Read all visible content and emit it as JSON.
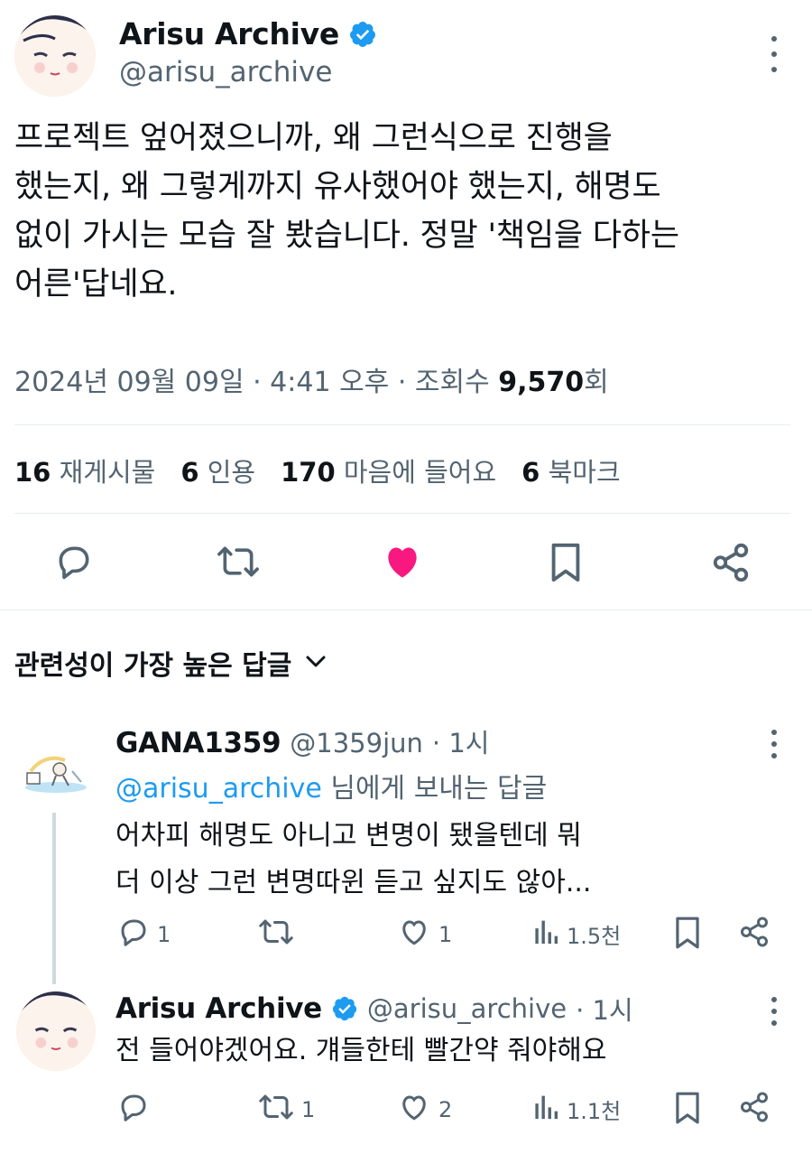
{
  "main_tweet": {
    "author_name": "Arisu Archive",
    "author_handle": "@arisu_archive",
    "text_lines": [
      "프로젝트 엎어졌으니까, 왜 그런식으로 진행을",
      "했는지, 왜 그렇게까지 유사했어야 했는지, 해명도",
      "없이 가시는 모습 잘 봤습니다. 정말 '책임을 다하는",
      "어른'답네요."
    ],
    "timestamp": "2024년 09월 09일 · 4:41 오후 · 조회수",
    "views_count": "9,570",
    "views_suffix": "회",
    "stats": [
      {
        "count": "16",
        "label": "재게시물"
      },
      {
        "count": "6",
        "label": "인용"
      },
      {
        "count": "170",
        "label": "마음에 들어요"
      },
      {
        "count": "6",
        "label": "북마크"
      }
    ],
    "like_color": "#f91880"
  },
  "replies_header": {
    "label": "관련성이 가장 높은 답글"
  },
  "replies": [
    {
      "author_name": "GANA1359",
      "author_handle": "@1359jun",
      "time": "· 1시",
      "replying_to_handle": "@arisu_archive",
      "replying_to_suffix": "님에게 보내는 답글",
      "text_lines": [
        "어차피 해명도 아니고 변명이 됐을텐데 뭐",
        "더 이상 그런 변명따윈 듣고 싶지도 않아..."
      ],
      "reply_count": "1",
      "repost_count": "",
      "like_count": "1",
      "view_count": "1.5천"
    },
    {
      "author_name": "Arisu Archive",
      "author_handle": "@arisu_archive",
      "time": "· 1시",
      "text_lines": [
        "전 들어야겠어요. 걔들한테 빨간약 줘야해요"
      ],
      "reply_count": "",
      "repost_count": "1",
      "like_count": "2",
      "view_count": "1.1천"
    }
  ],
  "colors": {
    "accent": "#1d9bf0",
    "muted": "#536471",
    "like": "#f91880"
  }
}
